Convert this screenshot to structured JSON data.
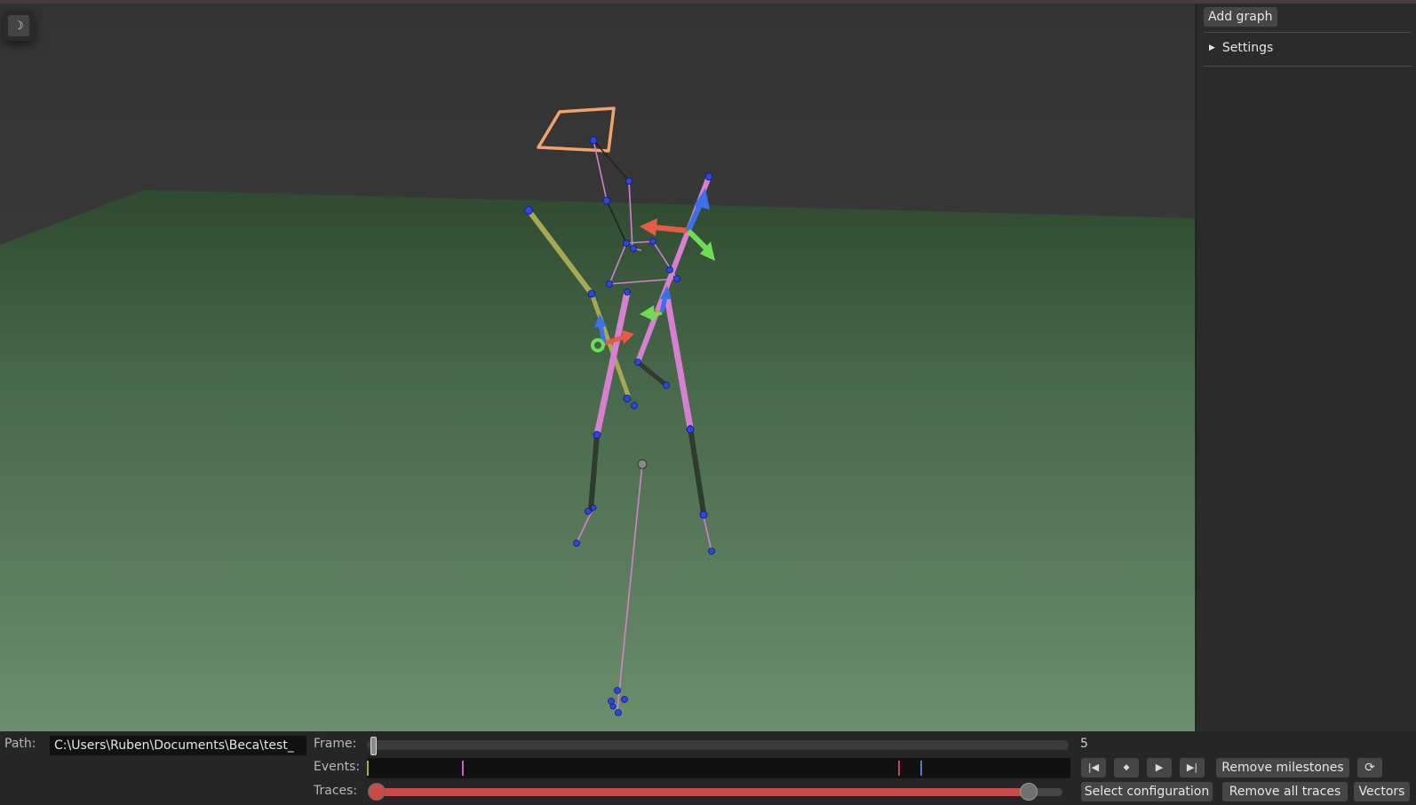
{
  "viewport": {
    "theme_toggle_icon": "moon-icon",
    "theme_toggle_glyph": "☽",
    "colors": {
      "floor_far": "#2e4a30",
      "floor_near": "#6b8e6c",
      "wall": "#3c3c3c",
      "bone_pink": "#d77fd0",
      "bone_olive": "#a7a854",
      "bone_dark": "#2e3b2e",
      "marker_blue": "#2c45e6",
      "head_box": "#f2a36c",
      "axis_red": "#e85a48",
      "axis_green": "#6fdc56",
      "axis_blue": "#3e6fea"
    }
  },
  "side_panel": {
    "add_graph_label": "Add graph",
    "settings_label": "Settings",
    "settings_expander_icon": "triangle-right-icon"
  },
  "bottom_bar": {
    "path_label": "Path:",
    "path_value": "C:\\Users\\Ruben\\Documents\\Beca\\test_",
    "frame_label": "Frame:",
    "frame_value": "5",
    "frame_progress": 0.005,
    "events_label": "Events:",
    "event_markers": [
      {
        "position": 0.0,
        "color": "#9bb33a"
      },
      {
        "position": 0.135,
        "color": "#d25fd0"
      },
      {
        "position": 0.755,
        "color": "#c0474f"
      },
      {
        "position": 0.787,
        "color": "#4f78d6"
      }
    ],
    "traces_label": "Traces:",
    "traces_range": [
      0.0,
      0.95
    ],
    "traces_color": "#c84a4a",
    "playback_icons": {
      "first": "skip-back-icon",
      "milestone": "diamond-icon",
      "play": "play-icon",
      "last": "skip-forward-icon",
      "refresh": "refresh-icon"
    },
    "playback_glyphs": {
      "first": "|◀",
      "milestone": "◆",
      "play": "▶",
      "last": "▶|",
      "refresh": "⟳"
    },
    "remove_milestones_label": "Remove milestones",
    "select_configuration_label": "Select configuration",
    "remove_all_traces_label": "Remove all traces",
    "vectors_label": "Vectors"
  }
}
